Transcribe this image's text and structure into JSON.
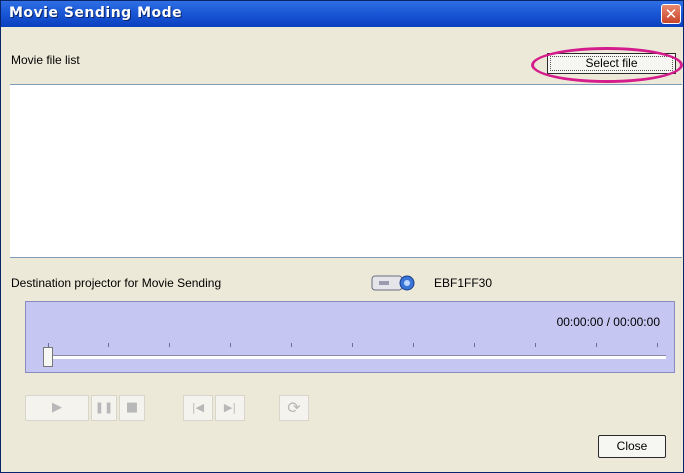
{
  "window": {
    "title": "Movie Sending Mode",
    "close_glyph": "✕"
  },
  "file_list": {
    "label": "Movie file list",
    "select_button": "Select file",
    "items": []
  },
  "destination": {
    "label": "Destination projector for Movie Sending",
    "projector_icon": "projector-icon",
    "projector_name": "EBF1FF30"
  },
  "player": {
    "time": "00:00:00 / 00:00:00",
    "progress": 0,
    "controls": {
      "play": "▶",
      "pause": "❚❚",
      "stop": "■",
      "prev": "|◀",
      "next": "▶|",
      "repeat": "⟳"
    }
  },
  "footer": {
    "close_button": "Close"
  },
  "colors": {
    "titlebar": "#1c5ad8",
    "player_bg": "#c5c7f2",
    "highlight": "#d41c8c"
  }
}
